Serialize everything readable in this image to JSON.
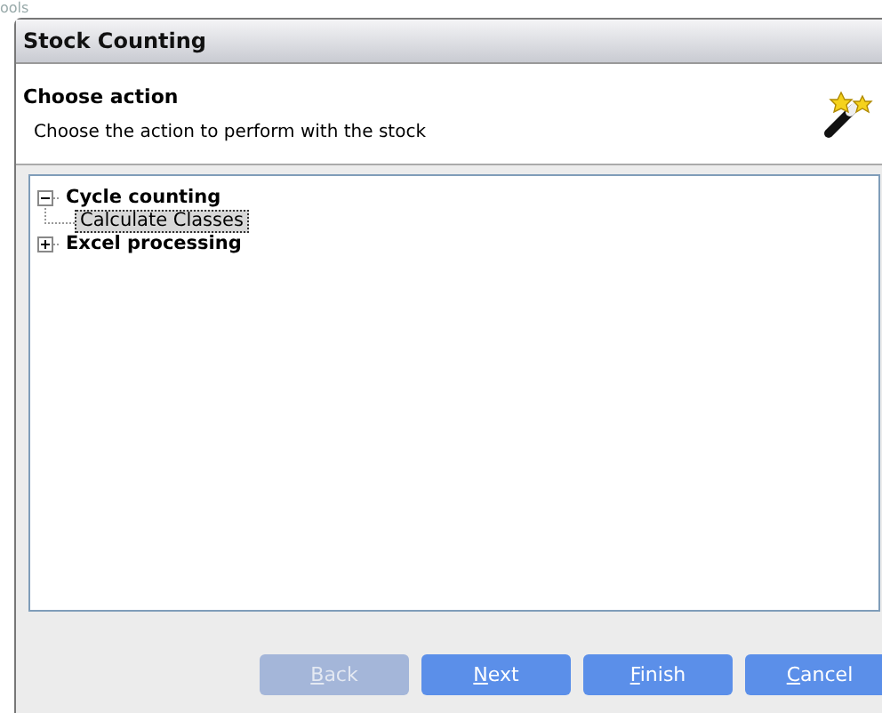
{
  "backdrop_text": "ools",
  "window": {
    "title": "Stock Counting"
  },
  "header": {
    "title": "Choose action",
    "subtitle": "Choose the action to perform with the stock"
  },
  "tree": [
    {
      "label": "Cycle counting",
      "expanded": true,
      "selected": false,
      "children": [
        {
          "label": "Calculate Classes",
          "selected": true
        }
      ]
    },
    {
      "label": "Excel processing",
      "expanded": false,
      "selected": false
    }
  ],
  "buttons": [
    {
      "label": "Back",
      "disabled": true
    },
    {
      "label": "Next",
      "disabled": false
    },
    {
      "label": "Finish",
      "disabled": false
    },
    {
      "label": "Cancel",
      "disabled": false
    }
  ]
}
